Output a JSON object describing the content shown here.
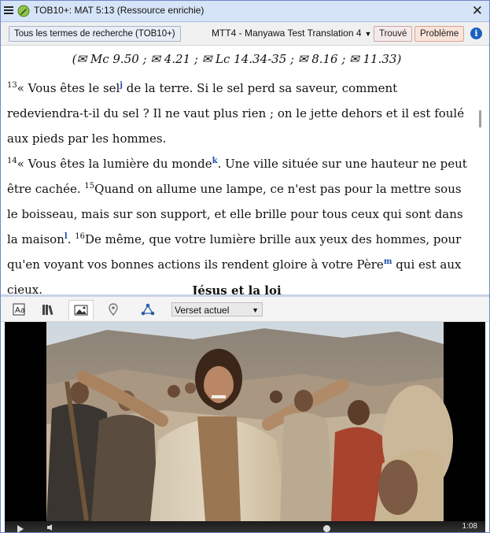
{
  "window": {
    "title": "TOB10+: MAT 5:13 (Ressource enrichie)"
  },
  "toolbar": {
    "search_terms_label": "Tous les termes de recherche (TOB10+)",
    "project_label": "MTT4 - Manyawa Test Translation 4",
    "found_label": "Trouvé",
    "problem_label": "Problème"
  },
  "text": {
    "references_line": "(✉ Mc 9.50 ; ✉ 4.21 ; ✉ Lc 14.34-35 ; ✉ 8.16 ; ✉ 11.33)",
    "v13_num": "13",
    "v13_a": "« Vous êtes le sel",
    "v13_fn": "j",
    "v13_b": " de la terre. Si le sel perd sa saveur, comment redeviendra-t-il du sel ? Il ne vaut plus rien ; on le jette dehors et il est foulé aux pieds par les hommes.",
    "v14_num": "14",
    "v14_a": "« Vous êtes la lumière du monde",
    "v14_fn": "k",
    "v14_b": ". Une ville située sur une hauteur ne peut être cachée. ",
    "v15_num": "15",
    "v15_a": "Quand on allume une lampe, ce n'est pas pour la mettre sous le boisseau, mais sur son support, et elle brille pour tous ceux qui sont dans la maison",
    "v15_fn": "l",
    "v15_b": ". ",
    "v16_num": "16",
    "v16_a": "De même, que votre lumière brille aux yeux des hommes, pour qu'en voyant vos bonnes actions ils rendent gloire à votre Père",
    "v16_fn": "m",
    "v16_b": " qui est aux cieux.",
    "section_heading": "Jésus et la loi"
  },
  "resource_toolbar": {
    "tabs": [
      "dictionary-icon",
      "library-icon",
      "image-icon",
      "map-pin-icon",
      "network-icon"
    ],
    "verse_select_value": "Verset actuel"
  },
  "video": {
    "time": "1:08"
  },
  "colors": {
    "title_bar": "#d6e4f7",
    "footnote_link": "#1e4fa8",
    "problem_bg": "#fae3d9",
    "info_blue": "#1b5fbf"
  }
}
